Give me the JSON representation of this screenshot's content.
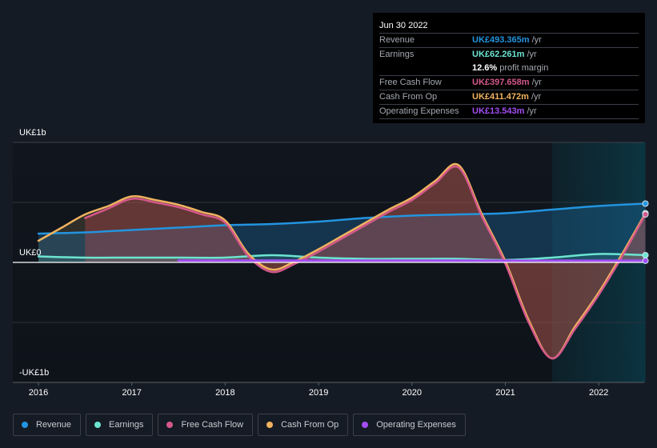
{
  "tooltip": {
    "date": "Jun 30 2022",
    "rows": [
      {
        "label": "Revenue",
        "value": "UK£493.365m",
        "unit": "/yr",
        "color": "#2394df"
      },
      {
        "label": "Earnings",
        "value": "UK£62.261m",
        "unit": "/yr",
        "color": "#6ce5d1"
      },
      {
        "label": "",
        "value": "12.6%",
        "unit": "profit margin",
        "color": "#ffffff"
      },
      {
        "label": "Free Cash Flow",
        "value": "UK£397.658m",
        "unit": "/yr",
        "color": "#d4588a"
      },
      {
        "label": "Cash From Op",
        "value": "UK£411.472m",
        "unit": "/yr",
        "color": "#f0b35f"
      },
      {
        "label": "Operating Expenses",
        "value": "UK£13.543m",
        "unit": "/yr",
        "color": "#a24ef2"
      }
    ]
  },
  "legend": [
    {
      "label": "Revenue",
      "color": "#2394df"
    },
    {
      "label": "Earnings",
      "color": "#6ce5d1"
    },
    {
      "label": "Free Cash Flow",
      "color": "#d4588a"
    },
    {
      "label": "Cash From Op",
      "color": "#f0b35f"
    },
    {
      "label": "Operating Expenses",
      "color": "#a24ef2"
    }
  ],
  "chart_data": {
    "type": "line",
    "title": "",
    "xlabel": "",
    "ylabel": "",
    "y_unit": "UK£ billions",
    "ylim": [
      -1.0,
      1.0
    ],
    "xlim": [
      2015.73,
      2022.5
    ],
    "y_ticks": [
      {
        "value": 1.0,
        "label": "UK£1b"
      },
      {
        "value": 0.0,
        "label": "UK£0"
      },
      {
        "value": -1.0,
        "label": "-UK£1b"
      }
    ],
    "x_ticks": [
      {
        "value": 2016,
        "label": "2016"
      },
      {
        "value": 2017,
        "label": "2017"
      },
      {
        "value": 2018,
        "label": "2018"
      },
      {
        "value": 2019,
        "label": "2019"
      },
      {
        "value": 2020,
        "label": "2020"
      },
      {
        "value": 2021,
        "label": "2021"
      },
      {
        "value": 2022,
        "label": "2022"
      }
    ],
    "grid": true,
    "highlight_range": [
      2021.5,
      2022.5
    ],
    "legend_position": "bottom-left",
    "series": [
      {
        "name": "Revenue",
        "color": "#2394df",
        "x": [
          2016.0,
          2016.5,
          2017.0,
          2017.5,
          2018.0,
          2018.5,
          2019.0,
          2019.5,
          2020.0,
          2020.5,
          2021.0,
          2021.5,
          2022.0,
          2022.5
        ],
        "y": [
          0.24,
          0.25,
          0.27,
          0.29,
          0.31,
          0.32,
          0.34,
          0.37,
          0.39,
          0.4,
          0.41,
          0.44,
          0.47,
          0.49
        ]
      },
      {
        "name": "Earnings",
        "color": "#6ce5d1",
        "x": [
          2016.0,
          2016.5,
          2017.0,
          2017.5,
          2018.0,
          2018.5,
          2019.0,
          2019.5,
          2020.0,
          2020.5,
          2021.0,
          2021.5,
          2022.0,
          2022.5
        ],
        "y": [
          0.05,
          0.04,
          0.04,
          0.04,
          0.04,
          0.06,
          0.04,
          0.03,
          0.03,
          0.03,
          0.02,
          0.04,
          0.07,
          0.06
        ]
      },
      {
        "name": "Free Cash Flow",
        "color": "#d4588a",
        "x": [
          2016.5,
          2016.75,
          2017.0,
          2017.25,
          2017.5,
          2017.75,
          2018.0,
          2018.25,
          2018.5,
          2018.75,
          2019.0,
          2019.25,
          2019.5,
          2019.75,
          2020.0,
          2020.25,
          2020.5,
          2020.75,
          2021.0,
          2021.25,
          2021.5,
          2021.75,
          2022.0,
          2022.25,
          2022.5
        ],
        "y": [
          0.37,
          0.45,
          0.53,
          0.5,
          0.46,
          0.4,
          0.33,
          0.05,
          -0.08,
          -0.01,
          0.09,
          0.2,
          0.31,
          0.42,
          0.52,
          0.66,
          0.79,
          0.38,
          -0.01,
          -0.5,
          -0.8,
          -0.55,
          -0.27,
          0.05,
          0.4
        ]
      },
      {
        "name": "Cash From Op",
        "color": "#f0b35f",
        "x": [
          2016.0,
          2016.25,
          2016.5,
          2016.75,
          2017.0,
          2017.25,
          2017.5,
          2017.75,
          2018.0,
          2018.25,
          2018.5,
          2018.75,
          2019.0,
          2019.25,
          2019.5,
          2019.75,
          2020.0,
          2020.25,
          2020.5,
          2020.75,
          2021.0,
          2021.25,
          2021.5,
          2021.75,
          2022.0,
          2022.25,
          2022.5
        ],
        "y": [
          0.18,
          0.29,
          0.4,
          0.47,
          0.55,
          0.52,
          0.48,
          0.42,
          0.35,
          0.07,
          -0.06,
          0.01,
          0.11,
          0.22,
          0.33,
          0.44,
          0.54,
          0.68,
          0.81,
          0.4,
          0.01,
          -0.48,
          -0.8,
          -0.53,
          -0.25,
          0.07,
          0.41
        ]
      },
      {
        "name": "Operating Expenses",
        "color": "#a24ef2",
        "x": [
          2017.5,
          2018.0,
          2018.5,
          2019.0,
          2019.5,
          2020.0,
          2020.5,
          2021.0,
          2021.5,
          2022.0,
          2022.5
        ],
        "y": [
          0.015,
          0.015,
          0.015,
          0.015,
          0.015,
          0.015,
          0.015,
          0.014,
          0.014,
          0.014,
          0.014
        ]
      }
    ]
  }
}
